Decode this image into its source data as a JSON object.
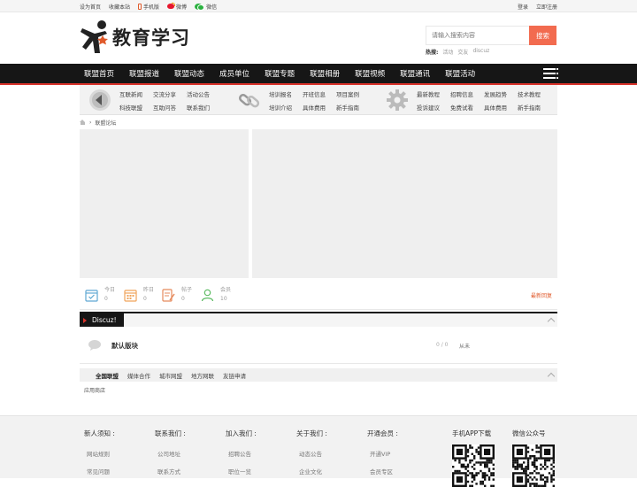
{
  "topbar": {
    "set_home": "设为首页",
    "bookmark": "收藏本站",
    "mobile": "手机版",
    "weibo": "微博",
    "wechat": "微信",
    "login": "登录",
    "register": "立即注册"
  },
  "header": {
    "logo_text": "教育学习",
    "search_placeholder": "请输入搜索内容",
    "search_button": "搜索",
    "hot_label": "热搜:",
    "hot_words": [
      "活动",
      "交友",
      "discuz"
    ]
  },
  "nav": {
    "items": [
      "联盟首页",
      "联盟报道",
      "联盟动态",
      "成员单位",
      "联盟专题",
      "联盟相册",
      "联盟视频",
      "联盟通讯",
      "联盟活动"
    ]
  },
  "subnav": {
    "group1": [
      "互联新闻",
      "交流分享",
      "活动公告",
      "科技联盟",
      "互助问答",
      "联系我们"
    ],
    "group2": [
      "培训报名",
      "开班信息",
      "项目案例",
      "培训介绍",
      "具体费用",
      "新手指南"
    ],
    "group3": [
      "最新教程",
      "招聘信息",
      "发展趋势",
      "技术教程",
      "投诉建议",
      "免费试看",
      "具体费用",
      "新手指南"
    ]
  },
  "breadcrumb": {
    "current": "联盟论坛"
  },
  "stats": {
    "today_label": "今日",
    "today_value": "0",
    "yesterday_label": "昨日",
    "yesterday_value": "0",
    "posts_label": "帖子",
    "posts_value": "0",
    "members_label": "会员",
    "members_value": "10",
    "newest_reply": "最新回复"
  },
  "category": {
    "title": "Discuz!"
  },
  "forum": {
    "name": "默认版块",
    "counts": "0 / 0",
    "last_post": "从未"
  },
  "links": {
    "tabs": [
      "全国联盟",
      "媒体合作",
      "城市网盟",
      "地方网联",
      "友链申请"
    ],
    "body": "应用商店"
  },
  "footer": {
    "col1": {
      "title": "新人须知 :",
      "links": [
        "网站规则",
        "常见问题"
      ]
    },
    "col2": {
      "title": "联系我们 :",
      "links": [
        "公司地址",
        "联系方式"
      ]
    },
    "col3": {
      "title": "加入我们 :",
      "links": [
        "招聘公告",
        "职位一览"
      ]
    },
    "col4": {
      "title": "关于我们 :",
      "links": [
        "动态公告",
        "企业文化"
      ]
    },
    "col5": {
      "title": "开通会员 :",
      "links": [
        "开通VIP",
        "会员专区"
      ]
    },
    "app_title": "手机APP下载",
    "wechat_title": "微信公众号"
  },
  "colors": {
    "nav_bg": "#161616",
    "accent_red": "#d9332b",
    "search_button": "#f26b4f"
  }
}
